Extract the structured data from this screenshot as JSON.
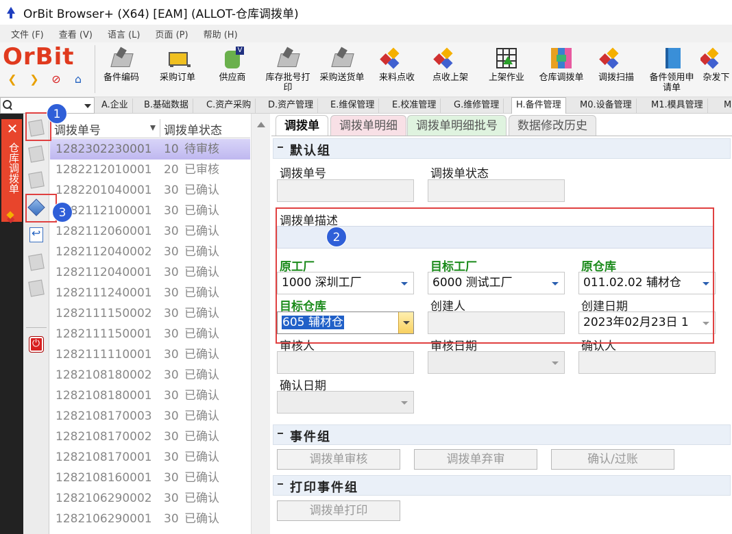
{
  "window": {
    "title": "OrBit Browser+ (X64) [EAM] (ALLOT-仓库调拨单)"
  },
  "menu": [
    "文件 (F)",
    "查看 (V)",
    "语言 (L)",
    "页面 (P)",
    "帮助 (H)"
  ],
  "logo": {
    "text": "OrBit"
  },
  "toolbar": [
    {
      "label": "备件编码",
      "icon": "disk-icon"
    },
    {
      "label": "采购订单",
      "icon": "cart-icon"
    },
    {
      "label": "供应商",
      "icon": "supplier-icon"
    },
    {
      "label": "库存批号打印",
      "icon": "disk-icon"
    },
    {
      "label": "采购送货单",
      "icon": "disk-icon"
    },
    {
      "label": "来料点收",
      "icon": "boxes-icon"
    },
    {
      "label": "点收上架",
      "icon": "boxes-icon"
    },
    {
      "label": "上架作业",
      "icon": "grid-icon"
    },
    {
      "label": "仓库调拨单",
      "icon": "transfer-icon"
    },
    {
      "label": "调拨扫描",
      "icon": "boxes-icon"
    },
    {
      "label": "备件领用申请单",
      "icon": "book-icon"
    },
    {
      "label": "杂发下",
      "icon": "boxes-icon"
    }
  ],
  "module_tabs": [
    "A.企业",
    "B.基础数据",
    "C.资产采购",
    "D.资产管理",
    "E.维保管理",
    "E.校准管理",
    "G.维修管理",
    "H.备件管理",
    "M0.设备管理",
    "M1.模具管理",
    "M"
  ],
  "active_module": "H.备件管理",
  "side_tab": {
    "label": "仓库调拨单",
    "close": "✕"
  },
  "list": {
    "col1": "调拨单号",
    "col2": "调拨单状态",
    "rows": [
      {
        "no": "1282302230001",
        "code": "10",
        "status": "待审核"
      },
      {
        "no": "1282212010001",
        "code": "20",
        "status": "已审核"
      },
      {
        "no": "1282201040001",
        "code": "30",
        "status": "已确认"
      },
      {
        "no": "1282112100001",
        "code": "30",
        "status": "已确认"
      },
      {
        "no": "1282112060001",
        "code": "30",
        "status": "已确认"
      },
      {
        "no": "1282112040002",
        "code": "30",
        "status": "已确认"
      },
      {
        "no": "1282112040001",
        "code": "30",
        "status": "已确认"
      },
      {
        "no": "1282111240001",
        "code": "30",
        "status": "已确认"
      },
      {
        "no": "1282111150002",
        "code": "30",
        "status": "已确认"
      },
      {
        "no": "1282111150001",
        "code": "30",
        "status": "已确认"
      },
      {
        "no": "1282111110001",
        "code": "30",
        "status": "已确认"
      },
      {
        "no": "1282108180002",
        "code": "30",
        "status": "已确认"
      },
      {
        "no": "1282108180001",
        "code": "30",
        "status": "已确认"
      },
      {
        "no": "1282108170003",
        "code": "30",
        "status": "已确认"
      },
      {
        "no": "1282108170002",
        "code": "30",
        "status": "已确认"
      },
      {
        "no": "1282108170001",
        "code": "30",
        "status": "已确认"
      },
      {
        "no": "1282108160001",
        "code": "30",
        "status": "已确认"
      },
      {
        "no": "1282106290002",
        "code": "30",
        "status": "已确认"
      },
      {
        "no": "1282106290001",
        "code": "30",
        "status": "已确认"
      }
    ]
  },
  "form_tabs": [
    "调拨单",
    "调拨单明细",
    "调拨单明细批号",
    "数据修改历史"
  ],
  "groups": {
    "default": "默认组",
    "events": "事件组",
    "print": "打印事件组"
  },
  "fields": {
    "transfer_no": {
      "label": "调拨单号",
      "value": ""
    },
    "transfer_status": {
      "label": "调拨单状态",
      "value": ""
    },
    "description": {
      "label": "调拨单描述",
      "value": ""
    },
    "source_factory": {
      "label": "原工厂",
      "value": "1000 深圳工厂"
    },
    "target_factory": {
      "label": "目标工厂",
      "value": "6000 测试工厂"
    },
    "source_warehouse": {
      "label": "原仓库",
      "value": "011.02.02 辅材仓"
    },
    "target_warehouse": {
      "label": "目标仓库",
      "value": "605 辅材仓"
    },
    "creator": {
      "label": "创建人",
      "value": ""
    },
    "create_date": {
      "label": "创建日期",
      "value": "2023年02月23日 1"
    },
    "reviewer": {
      "label": "审核人",
      "value": ""
    },
    "review_date": {
      "label": "审核日期",
      "value": ""
    },
    "confirmer": {
      "label": "确认人",
      "value": ""
    },
    "confirm_date": {
      "label": "确认日期",
      "value": ""
    }
  },
  "event_buttons": [
    "调拨单审核",
    "调拨单弃审",
    "确认/过账"
  ],
  "print_buttons": [
    "调拨单打印"
  ],
  "annotations": [
    "1",
    "2",
    "3"
  ],
  "colors": {
    "accent_red": "#e8452c",
    "required_green": "#1a8a1a",
    "selection_blue": "#2060c8",
    "badge_blue": "#2f5fd8"
  }
}
